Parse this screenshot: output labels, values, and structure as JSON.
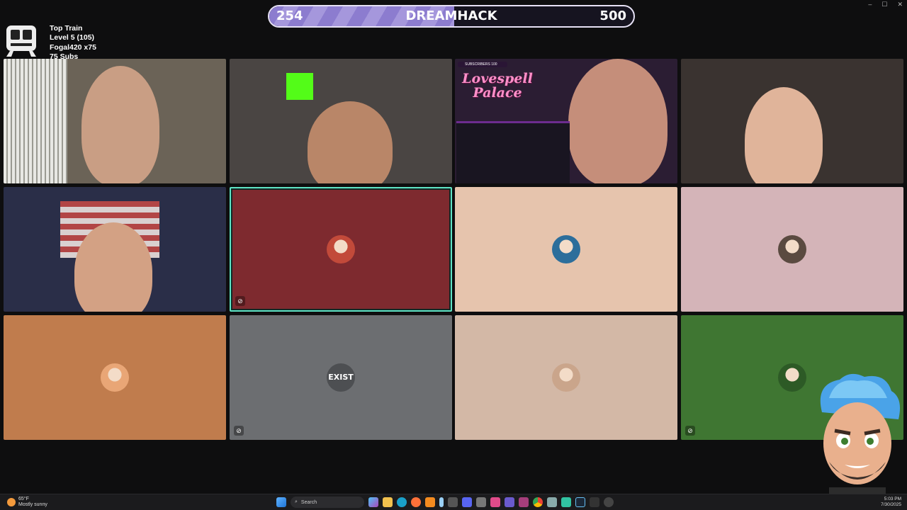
{
  "goal": {
    "current": "254",
    "title": "DREAMHACK",
    "target": "500",
    "progress": 0.508
  },
  "train": {
    "title": "Top Train",
    "level": "Level 5  (105)",
    "top": "Fogal420 x75",
    "subs": "75 Subs"
  },
  "stream_overlay": {
    "subscribers_label": "SUBSCRIBERS  100",
    "brand_line1": "Lovespell",
    "brand_line2": "Palace"
  },
  "tiles": [
    {
      "kind": "camera",
      "bg": "#6b6357"
    },
    {
      "kind": "camera",
      "bg": "#4a4543"
    },
    {
      "kind": "camera",
      "bg": "#2b1d33"
    },
    {
      "kind": "camera",
      "bg": "#3a3330"
    },
    {
      "kind": "camera",
      "bg": "#2a2e48"
    },
    {
      "kind": "avatar",
      "bg": "#7e2a2f",
      "avatar": "#c24a3a"
    },
    {
      "kind": "avatar",
      "bg": "#e6c4ad",
      "avatar": "#2c6e9b"
    },
    {
      "kind": "avatar",
      "bg": "#d4b4b8",
      "avatar": "#5a4a40"
    },
    {
      "kind": "avatar",
      "bg": "#c07c4d",
      "avatar": "#e9a676"
    },
    {
      "kind": "avatar",
      "bg": "#6c6e71",
      "avatar": "#555",
      "label": "EXIST"
    },
    {
      "kind": "avatar",
      "bg": "#d3b8a6",
      "avatar": "#caa58b"
    },
    {
      "kind": "avatar",
      "bg": "#3f7632",
      "avatar": "#2d5a26"
    }
  ],
  "taskbar": {
    "weather_temp": "65°F",
    "weather_desc": "Mostly sunny",
    "search_placeholder": "Search",
    "time": "5:03 PM",
    "date": "7/30/2025"
  },
  "colors": {
    "highlight": "#5fe3c5",
    "goal_fill": "#8c7ccf"
  }
}
